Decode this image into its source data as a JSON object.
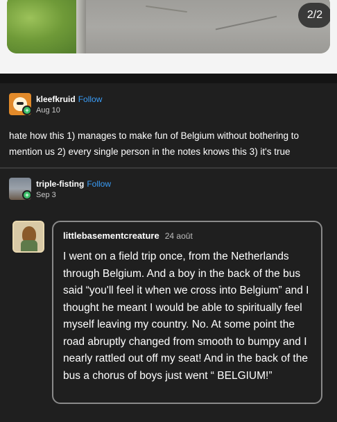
{
  "image_post": {
    "counter": "2/2"
  },
  "reblogs": [
    {
      "username": "kleefkruid",
      "follow_label": "Follow",
      "date": "Aug 10",
      "text": "hate how this 1) manages to make fun of Belgium without bothering to mention us 2) every single person in the notes knows this 3) it's true"
    },
    {
      "username": "triple-fisting",
      "follow_label": "Follow",
      "date": "Sep 3"
    }
  ],
  "quote": {
    "username": "littlebasementcreature",
    "date": "24 août",
    "text": "I went on a field trip once, from the Netherlands through Belgium. And a boy in the back of the bus said “you'll feel it when we cross into Belgium” and I thought he meant I would be able to spiritually feel myself leaving my country. No. At some point the road abruptly changed from smooth to bumpy and I nearly rattled out off my seat! And in the back of the bus a chorus of boys just went “ BELGIUM!”"
  },
  "colors": {
    "background": "#1f1f1f",
    "text": "#ffffff",
    "follow": "#3a9df7",
    "badge": "#3cc06a"
  },
  "icons": [
    "photo-image",
    "avatar",
    "avatar-status-badge"
  ]
}
